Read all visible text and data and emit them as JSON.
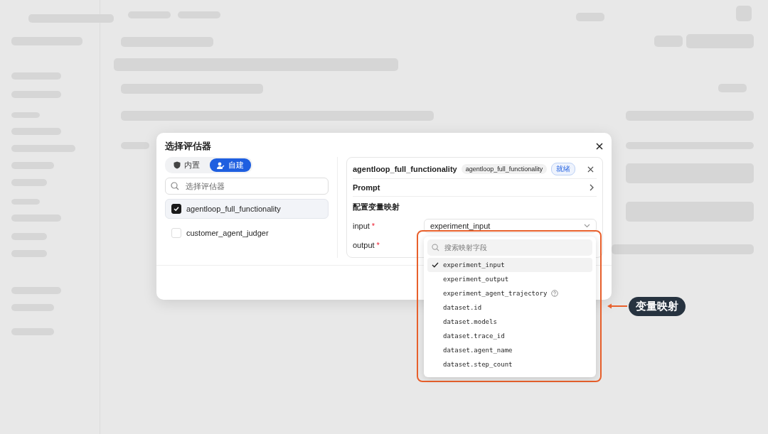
{
  "dialog": {
    "title": "选择评估器",
    "tabs": [
      {
        "label": "内置",
        "kind": "builtin",
        "selected": false
      },
      {
        "label": "自建",
        "kind": "custom",
        "selected": true
      }
    ],
    "search": {
      "placeholder": "选择评估器"
    },
    "evaluators": [
      {
        "name": "agentloop_full_functionality",
        "checked": true,
        "selected": true
      },
      {
        "name": "customer_agent_judger",
        "checked": false,
        "selected": false
      }
    ],
    "detail": {
      "name": "agentloop_full_functionality",
      "tag": "agentloop_full_functionality",
      "status": "就绪",
      "section": "Prompt",
      "mapping_title": "配置变量映射",
      "fields": [
        {
          "label": "input",
          "required_mark": "*",
          "value": "experiment_input"
        },
        {
          "label": "output",
          "required_mark": "*"
        }
      ]
    }
  },
  "dropdown": {
    "placeholder": "搜索映射字段",
    "options": [
      {
        "label": "experiment_input",
        "selected": true,
        "help": false
      },
      {
        "label": "experiment_output",
        "selected": false,
        "help": false
      },
      {
        "label": "experiment_agent_trajectory",
        "selected": false,
        "help": true
      },
      {
        "label": "dataset.id",
        "selected": false,
        "help": false
      },
      {
        "label": "dataset.models",
        "selected": false,
        "help": false
      },
      {
        "label": "dataset.trace_id",
        "selected": false,
        "help": false
      },
      {
        "label": "dataset.agent_name",
        "selected": false,
        "help": false
      },
      {
        "label": "dataset.step_count",
        "selected": false,
        "help": false
      }
    ]
  },
  "callout": {
    "label": "变量映射"
  }
}
